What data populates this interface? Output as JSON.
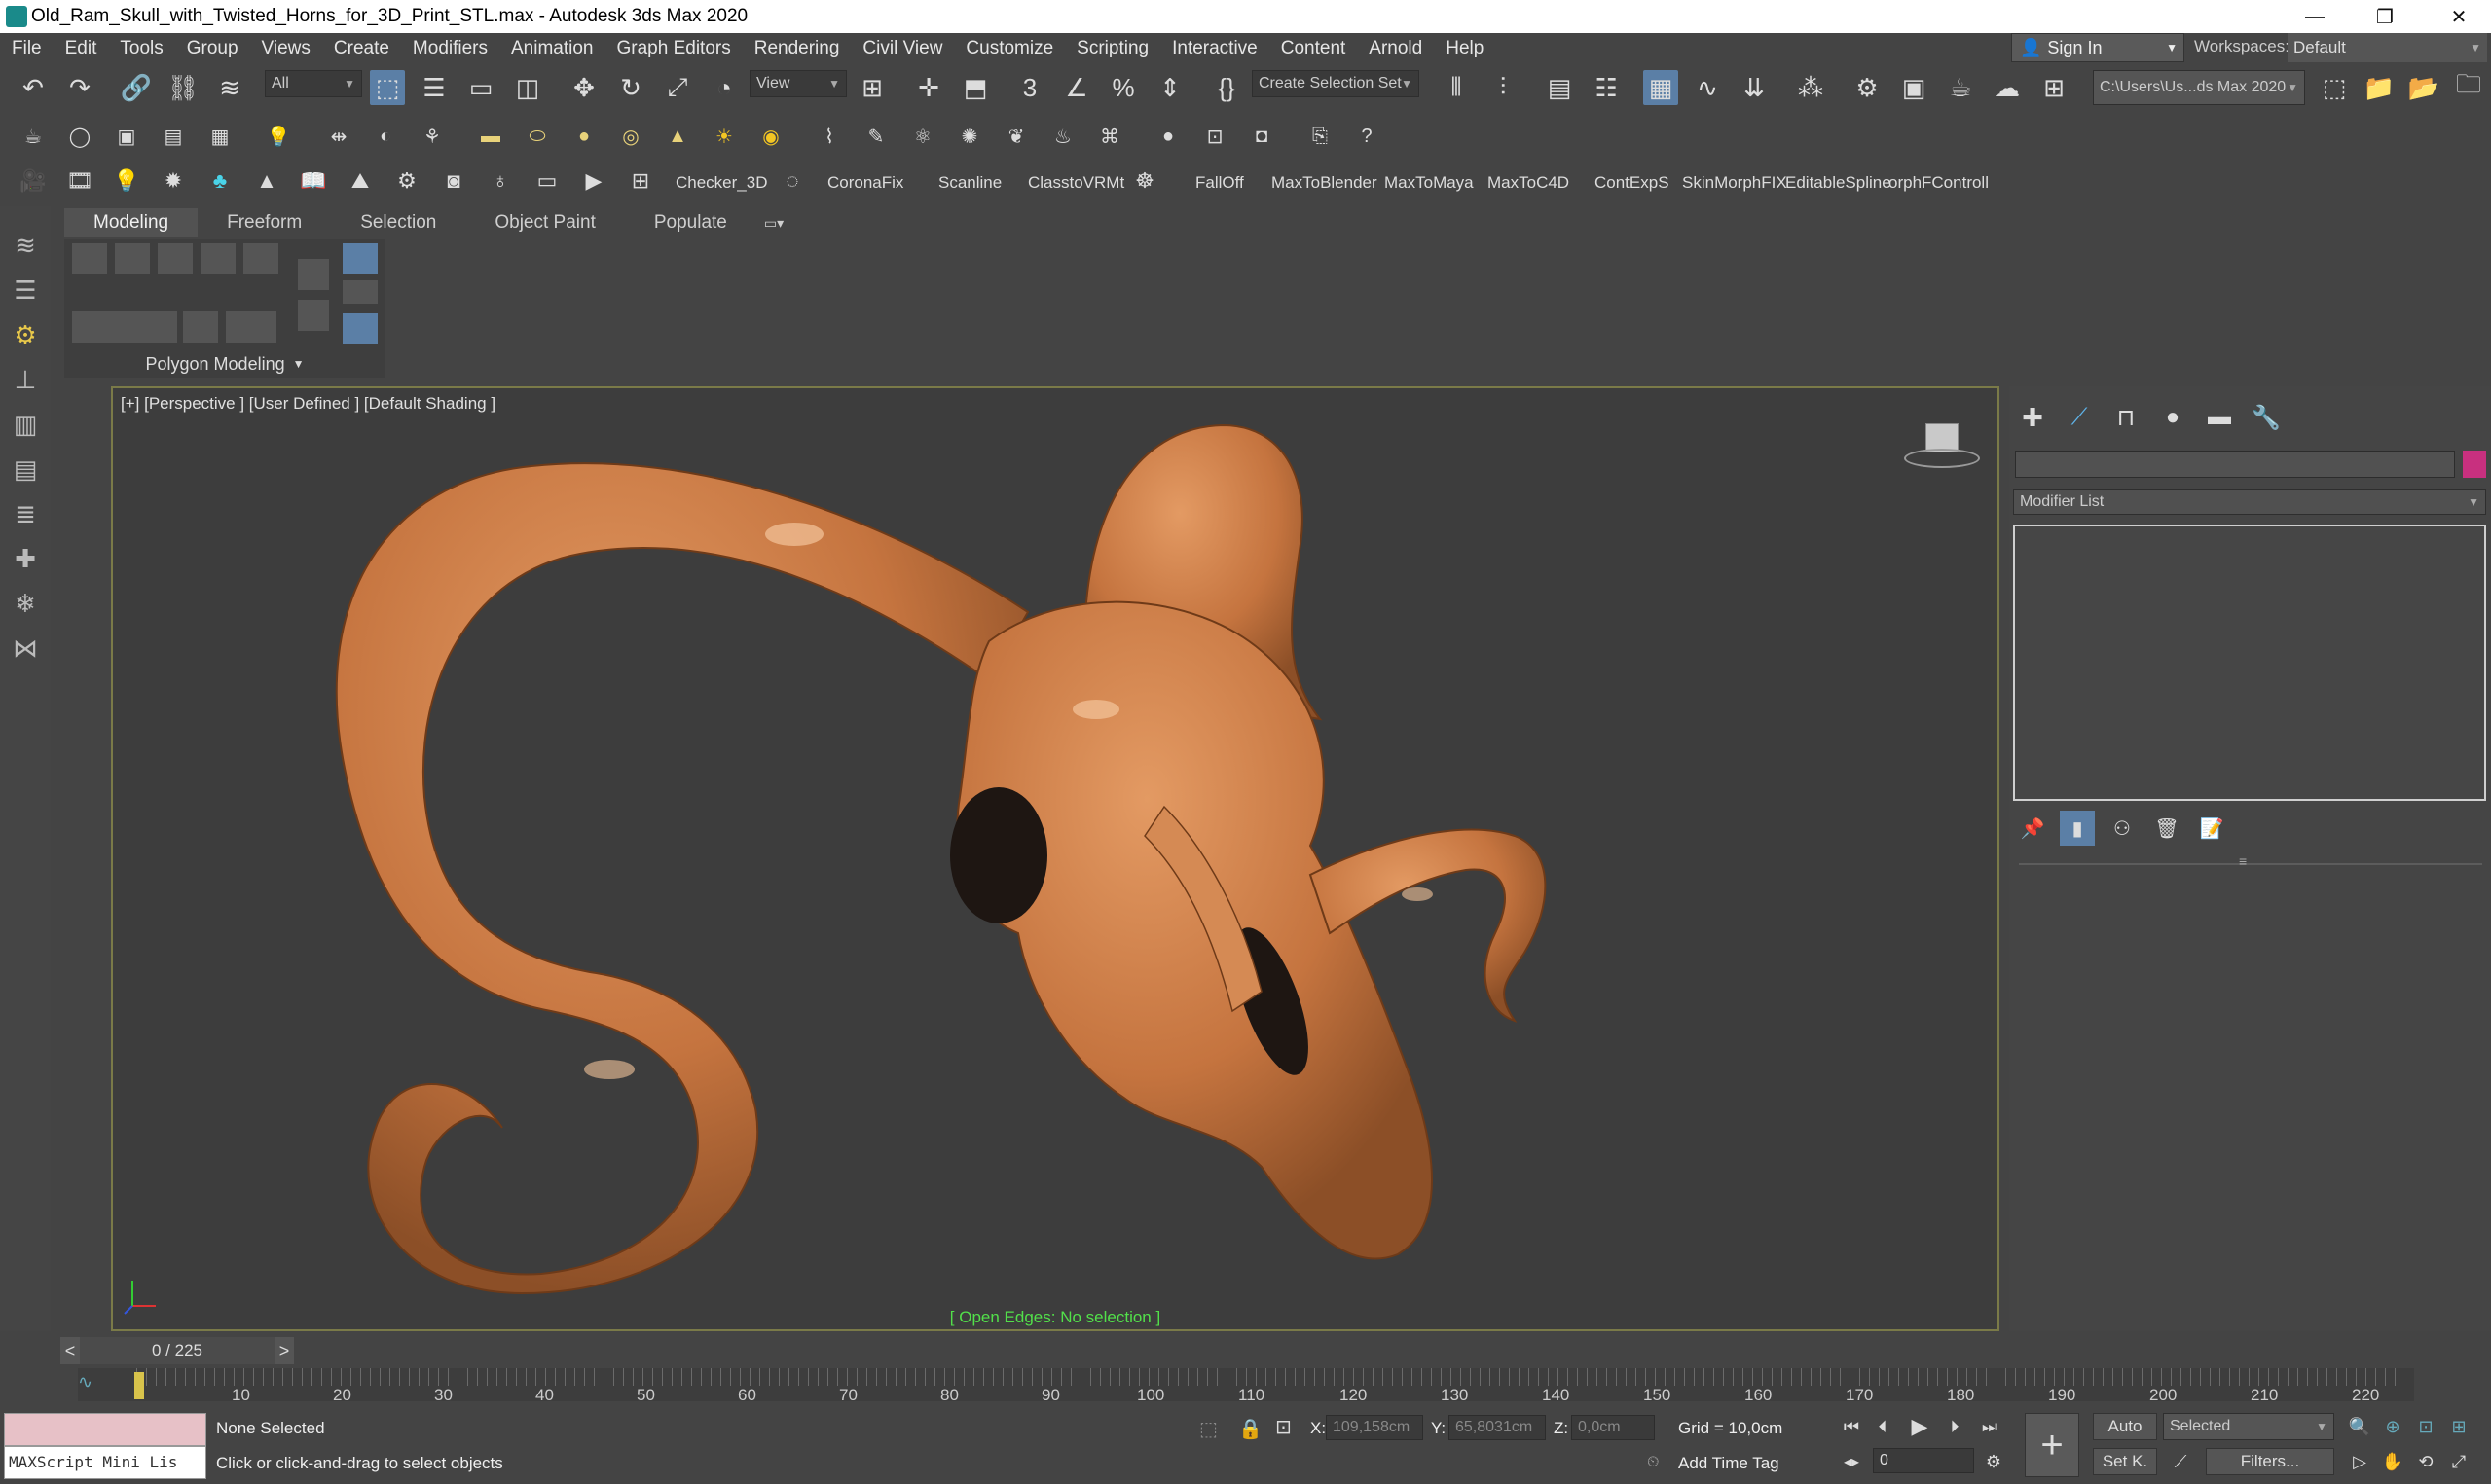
{
  "window": {
    "title": "Old_Ram_Skull_with_Twisted_Horns_for_3D_Print_STL.max - Autodesk 3ds Max 2020",
    "minimize": "—",
    "maximize": "❐",
    "close": "✕"
  },
  "menu": [
    "File",
    "Edit",
    "Tools",
    "Group",
    "Views",
    "Create",
    "Modifiers",
    "Animation",
    "Graph Editors",
    "Rendering",
    "Civil View",
    "Customize",
    "Scripting",
    "Interactive",
    "Content",
    "Arnold",
    "Help"
  ],
  "account": {
    "sign_in": "Sign In",
    "workspaces_label": "Workspaces:",
    "workspace": "Default"
  },
  "main_toolbar": {
    "selection_filter": "All",
    "ref_coord": "View",
    "selection_set": "Create Selection Set",
    "project_path": "C:\\Users\\Us...ds Max 2020"
  },
  "plugin_toolbar": [
    "Checker_3D",
    "CoronaFix",
    "Scanline",
    "ClasstoVRMt",
    "FallOff",
    "MaxToBlender",
    "MaxToMaya",
    "MaxToC4D",
    "ContExpS",
    "SkinMorphFIX",
    "EditableSpline",
    "orphFControll"
  ],
  "ribbon": {
    "tabs": [
      "Modeling",
      "Freeform",
      "Selection",
      "Object Paint",
      "Populate"
    ],
    "panel_label": "Polygon Modeling"
  },
  "viewport": {
    "label": "[+] [Perspective ] [User Defined ] [Default Shading ]",
    "status": "[ Open Edges: No selection ]",
    "model_color": "#c77a45"
  },
  "command_panel": {
    "modifier_list": "Modifier List",
    "color_swatch": "#c8307f"
  },
  "timeline": {
    "frame_counter": "0 / 225",
    "prev": "<",
    "next": ">",
    "ticks": [
      "10",
      "20",
      "30",
      "40",
      "50",
      "60",
      "70",
      "80",
      "90",
      "100",
      "110",
      "120",
      "130",
      "140",
      "150",
      "160",
      "170",
      "180",
      "190",
      "200",
      "210",
      "220"
    ]
  },
  "status": {
    "maxscript": "MAXScript Mini Lis",
    "selection": "None Selected",
    "prompt": "Click or click-and-drag to select objects",
    "x_label": "X:",
    "x": "109,158cm",
    "y_label": "Y:",
    "y": "65,8031cm",
    "z_label": "Z:",
    "z": "0,0cm",
    "grid": "Grid = 10,0cm",
    "add_time_tag": "Add Time Tag",
    "auto": "Auto",
    "selected": "Selected",
    "set_key": "Set K.",
    "filters": "Filters...",
    "frame": "0"
  }
}
